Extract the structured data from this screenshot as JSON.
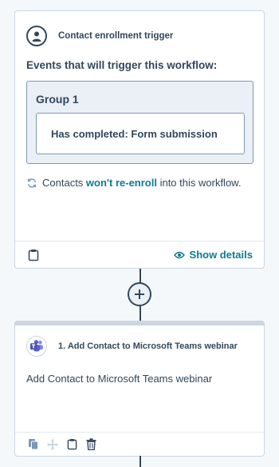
{
  "trigger": {
    "title": "Contact enrollment trigger",
    "events_heading": "Events that will trigger this workflow:",
    "group_title": "Group 1",
    "filter": "Has completed: Form submission",
    "reenroll_prefix": "Contacts ",
    "reenroll_link": "won't re-enroll",
    "reenroll_suffix": " into this workflow.",
    "show_details": "Show details"
  },
  "action": {
    "title": "1. Add Contact to Microsoft Teams webinar",
    "description": "Add Contact to Microsoft Teams webinar"
  },
  "icons": {
    "trigger": "contact-avatar-icon",
    "reenroll": "refresh-icon",
    "clipboard": "clipboard-icon",
    "eye": "eye-icon",
    "plus": "plus-icon",
    "teams": "microsoft-teams-icon",
    "copy": "copy-icon",
    "move": "move-icon",
    "delete": "trash-icon"
  },
  "colors": {
    "text": "#33475b",
    "link": "#0b7c8f",
    "border": "#cbd6e2",
    "group_bg": "#eaf0f6",
    "teams": "#5b5fc7"
  }
}
